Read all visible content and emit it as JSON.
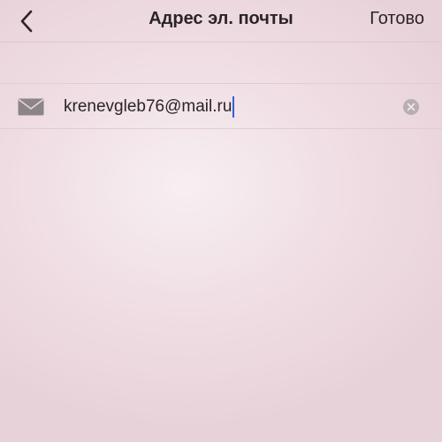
{
  "nav": {
    "back_icon": "chevron-left-icon",
    "title": "Адрес эл. почты",
    "done_label": "Готово"
  },
  "email_field": {
    "leading_icon": "mail-icon",
    "value": "krenevgleb76@mail.ru",
    "clear_icon": "clear-circle-icon",
    "caret_color": "#2f62d8"
  },
  "colors": {
    "background": "#efdde3",
    "separator": "#dcc7ce",
    "icon_gray": "#8c8588",
    "text": "#2b2426"
  }
}
